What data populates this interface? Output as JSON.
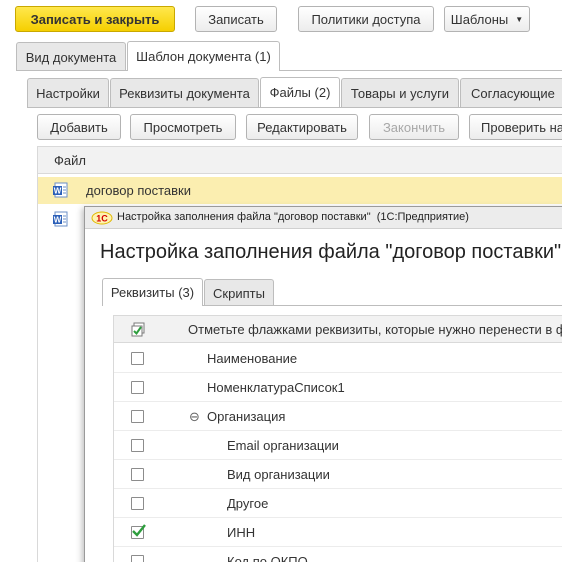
{
  "toolbar": {
    "save_close_label": "Записать и закрыть",
    "save_label": "Записать",
    "access_policies_label": "Политики доступа",
    "templates_label": "Шаблоны"
  },
  "outer_tabs": [
    "Вид документа",
    "Шаблон документа (1)"
  ],
  "inner_tabs": [
    "Настройки",
    "Реквизиты документа",
    "Файлы (2)",
    "Товары и услуги",
    "Согласующие"
  ],
  "files_toolbar": {
    "add_label": "Добавить",
    "view_label": "Просмотреть",
    "edit_label": "Редактировать",
    "finish_label": "Закончить",
    "check_label": "Проверить на"
  },
  "files_table": {
    "column_file": "Файл",
    "rows": [
      "договор поставки"
    ]
  },
  "dialog": {
    "app_title": "Настройка заполнения файла \"договор поставки\"  (1С:Предприятие)",
    "heading": "Настройка заполнения файла \"договор поставки\"",
    "tabs": [
      "Реквизиты (3)",
      "Скрипты"
    ],
    "grid_header": "Отметьте флажками реквизиты, которые нужно перенести в фа",
    "rows": [
      {
        "label": "Наименование",
        "checked": false,
        "level": 0
      },
      {
        "label": "НоменклатураСписок1",
        "checked": false,
        "level": 0
      },
      {
        "label": "Организация",
        "checked": false,
        "level": 0,
        "expander": "⊖"
      },
      {
        "label": "Email организации",
        "checked": false,
        "level": 1
      },
      {
        "label": "Вид организации",
        "checked": false,
        "level": 1
      },
      {
        "label": "Другое",
        "checked": false,
        "level": 1
      },
      {
        "label": "ИНН",
        "checked": true,
        "level": 1
      },
      {
        "label": "Код по ОКПО",
        "checked": false,
        "level": 1
      }
    ]
  },
  "colors": {
    "primary_button": "#f5cf00",
    "selected_row": "#fbeeb0",
    "check_mark": "#2e9e3e"
  }
}
